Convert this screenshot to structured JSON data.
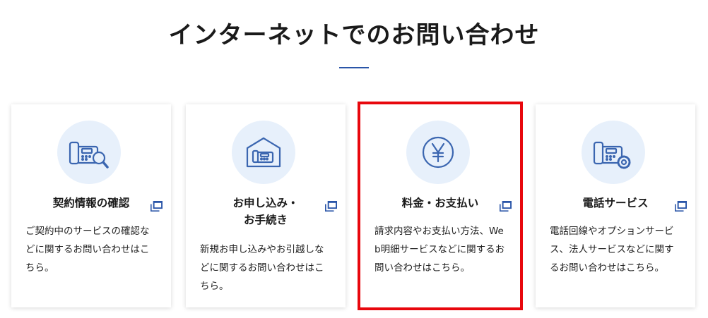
{
  "section": {
    "title": "インターネットでのお問い合わせ"
  },
  "cards": [
    {
      "title_lines": [
        "契約情報の確認"
      ],
      "description": "ご契約中のサービスの確認などに関するお問い合わせはこちら。",
      "icon": "phone-search-icon"
    },
    {
      "title_lines": [
        "お申し込み・",
        "お手続き"
      ],
      "description": "新規お申し込みやお引越しなどに関するお問い合わせはこちら。",
      "icon": "phone-house-icon"
    },
    {
      "title_lines": [
        "料金・お支払い"
      ],
      "description": "請求内容やお支払い方法、Web明細サービスなどに関するお問い合わせはこちら。",
      "icon": "yen-icon",
      "highlighted": true
    },
    {
      "title_lines": [
        "電話サービス"
      ],
      "description": "電話回線やオプションサービス、法人サービスなどに関するお問い合わせはこちら。",
      "icon": "phone-gear-icon"
    }
  ],
  "colors": {
    "accent": "#2a55a8",
    "icon_line": "#3b66b0",
    "icon_bg": "#e7f0fb",
    "highlight": "#e8070d"
  }
}
